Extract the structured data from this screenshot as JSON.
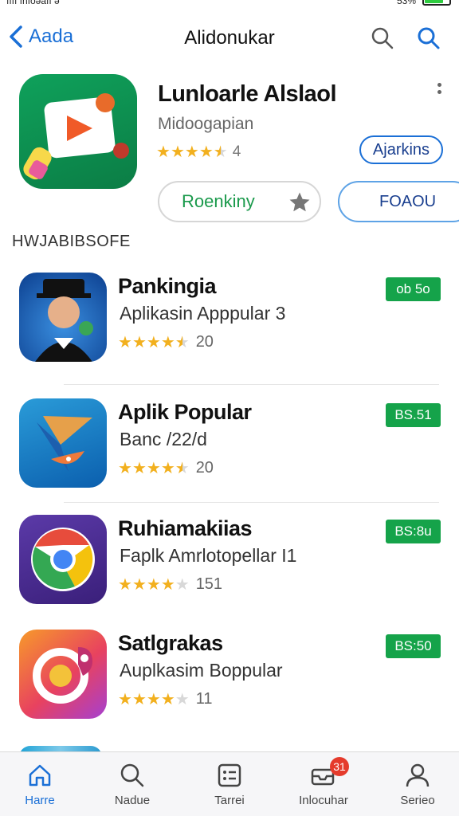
{
  "status_bar": {
    "left_text": "ıııı ınıoǝaıı ǝ",
    "battery_text": "53%",
    "battery_level": 0.78
  },
  "nav": {
    "back_label": "Aada",
    "title": "Alidonukar",
    "icons": [
      "search-icon",
      "search-icon"
    ],
    "accent": "#1a6fd6"
  },
  "featured": {
    "title": "Lunloarle Alslaol",
    "subtitle": "Midoogapian",
    "rating_stars": 4.5,
    "rating_count": "4",
    "pill_blue": "Ajarkins",
    "pill_green": "Roenkiny",
    "pill_blue2": "FOAOU"
  },
  "section_header": "HWJABIBSOFE",
  "apps": [
    {
      "name": "Pankingia",
      "desc": "Aplikasin Apppular 3",
      "stars": 4.5,
      "count": "20",
      "price": "ob 5o",
      "icon": "avatar-icon"
    },
    {
      "name": "Aplik Popular",
      "desc": "Banc /22/d",
      "stars": 4.5,
      "count": "20",
      "price": "BS.51",
      "icon": "plane-icon"
    },
    {
      "name": "Ruhiamakiias",
      "desc": "Faplk Amrlotopellar I1",
      "stars": 4,
      "count": "151",
      "price": "BS:8u",
      "icon": "browser-icon"
    },
    {
      "name": "Satlgrakas",
      "desc": "Auplkasim Boppular",
      "stars": 4,
      "count": "11",
      "price": "BS:50",
      "icon": "camera-icon"
    }
  ],
  "tabs": [
    {
      "label": "Harre",
      "icon": "home-icon",
      "active": true
    },
    {
      "label": "Nadue",
      "icon": "search-icon",
      "active": false
    },
    {
      "label": "Tarrei",
      "icon": "list-icon",
      "active": false
    },
    {
      "label": "Inlocuhar",
      "icon": "inbox-icon",
      "active": false,
      "badge": "31"
    },
    {
      "label": "Serieo",
      "icon": "person-icon",
      "active": false
    }
  ],
  "colors": {
    "price_green": "#15a34a",
    "star_gold": "#f2b01e",
    "link_blue": "#1a6fd6"
  }
}
